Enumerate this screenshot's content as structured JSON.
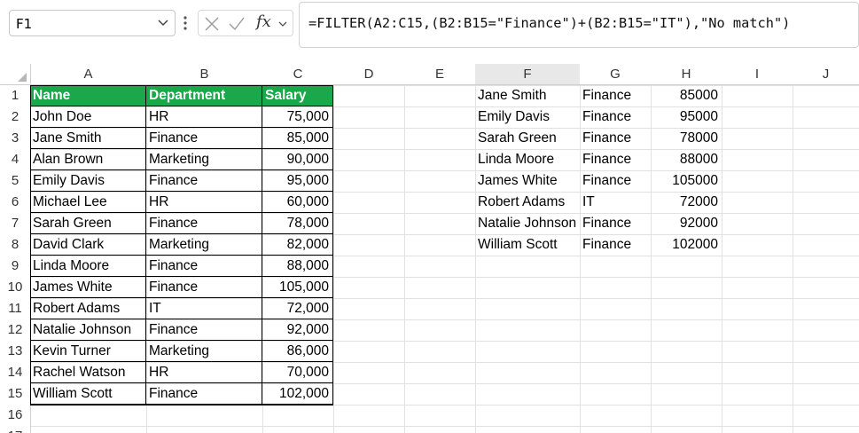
{
  "formula_bar": {
    "name_box": "F1",
    "fx_label": "fx",
    "formula": "=FILTER(A2:C15,(B2:B15=\"Finance\")+(B2:B15=\"IT\"),\"No match\")"
  },
  "columns": [
    "A",
    "B",
    "C",
    "D",
    "E",
    "F",
    "G",
    "H",
    "I",
    "J"
  ],
  "rows": [
    "1",
    "2",
    "3",
    "4",
    "5",
    "6",
    "7",
    "8",
    "9",
    "10",
    "11",
    "12",
    "13",
    "14",
    "15",
    "16",
    "17"
  ],
  "table": {
    "headers": [
      "Name",
      "Department",
      "Salary"
    ],
    "rows": [
      [
        "John Doe",
        "HR",
        "75,000"
      ],
      [
        "Jane Smith",
        "Finance",
        "85,000"
      ],
      [
        "Alan Brown",
        "Marketing",
        "90,000"
      ],
      [
        "Emily Davis",
        "Finance",
        "95,000"
      ],
      [
        "Michael Lee",
        "HR",
        "60,000"
      ],
      [
        "Sarah Green",
        "Finance",
        "78,000"
      ],
      [
        "David Clark",
        "Marketing",
        "82,000"
      ],
      [
        "Linda Moore",
        "Finance",
        "88,000"
      ],
      [
        "James White",
        "Finance",
        "105,000"
      ],
      [
        "Robert Adams",
        "IT",
        "72,000"
      ],
      [
        "Natalie Johnson",
        "Finance",
        "92,000"
      ],
      [
        "Kevin Turner",
        "Marketing",
        "86,000"
      ],
      [
        "Rachel Watson",
        "HR",
        "70,000"
      ],
      [
        "William Scott",
        "Finance",
        "102,000"
      ]
    ],
    "header_color": "#1aa84b"
  },
  "results": [
    [
      "Jane Smith",
      "Finance",
      "85000"
    ],
    [
      "Emily Davis",
      "Finance",
      "95000"
    ],
    [
      "Sarah Green",
      "Finance",
      "78000"
    ],
    [
      "Linda Moore",
      "Finance",
      "88000"
    ],
    [
      "James White",
      "Finance",
      "105000"
    ],
    [
      "Robert Adams",
      "IT",
      "72000"
    ],
    [
      "Natalie Johnson",
      "Finance",
      "92000"
    ],
    [
      "William Scott",
      "Finance",
      "102000"
    ]
  ]
}
